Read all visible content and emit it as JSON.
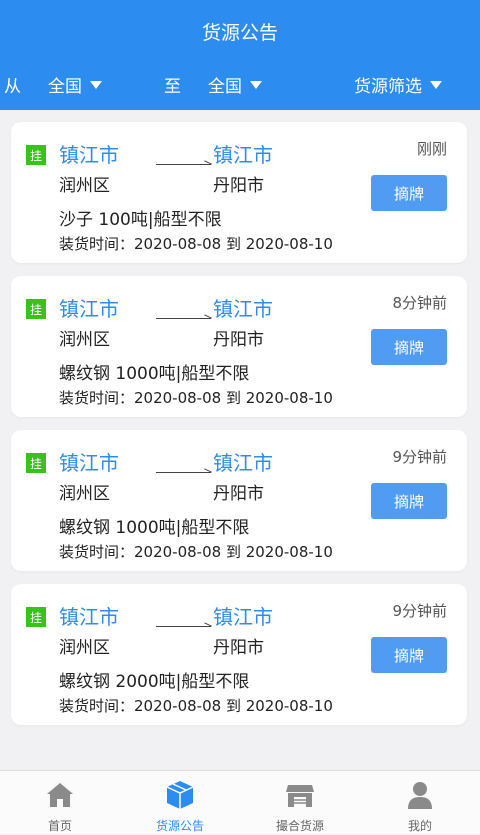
{
  "header": {
    "title": "货源公告"
  },
  "filters": {
    "from_label": "从",
    "from_value": "全国",
    "to_label": "至",
    "to_value": "全国",
    "filter_label": "货源筛选"
  },
  "listings": [
    {
      "badge": "挂",
      "from_city": "镇江市",
      "from_district": "润州区",
      "to_city": "镇江市",
      "to_district": "丹阳市",
      "cargo": "沙子 100吨|船型不限",
      "load_time": "装货时间：2020-08-08 到 2020-08-10",
      "time_ago": "刚刚",
      "action": "摘牌"
    },
    {
      "badge": "挂",
      "from_city": "镇江市",
      "from_district": "润州区",
      "to_city": "镇江市",
      "to_district": "丹阳市",
      "cargo": "螺纹钢 1000吨|船型不限",
      "load_time": "装货时间：2020-08-08 到 2020-08-10",
      "time_ago": "8分钟前",
      "action": "摘牌"
    },
    {
      "badge": "挂",
      "from_city": "镇江市",
      "from_district": "润州区",
      "to_city": "镇江市",
      "to_district": "丹阳市",
      "cargo": "螺纹钢 1000吨|船型不限",
      "load_time": "装货时间：2020-08-08 到 2020-08-10",
      "time_ago": "9分钟前",
      "action": "摘牌"
    },
    {
      "badge": "挂",
      "from_city": "镇江市",
      "from_district": "润州区",
      "to_city": "镇江市",
      "to_district": "丹阳市",
      "cargo": "螺纹钢 2000吨|船型不限",
      "load_time": "装货时间：2020-08-08 到 2020-08-10",
      "time_ago": "9分钟前",
      "action": "摘牌"
    }
  ],
  "tabbar": {
    "items": [
      {
        "label": "首页",
        "icon": "home-icon",
        "active": false
      },
      {
        "label": "货源公告",
        "icon": "box-icon",
        "active": true
      },
      {
        "label": "撮合货源",
        "icon": "store-icon",
        "active": false
      },
      {
        "label": "我的",
        "icon": "user-icon",
        "active": false
      }
    ]
  },
  "colors": {
    "primary": "#2d8cf0",
    "badge": "#38c31b",
    "button": "#4f9cf2",
    "inactive_icon": "#8a8a8a"
  }
}
